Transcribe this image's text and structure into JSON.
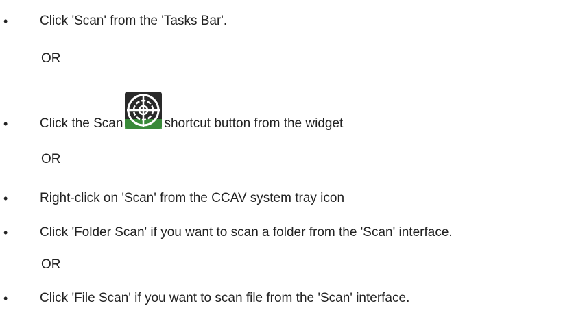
{
  "bullet_symbol": "•",
  "or_text": "OR",
  "steps": [
    "Click 'Scan' from the 'Tasks Bar'.",
    "Click the Scan",
    "shortcut button from the widget",
    "Right-click on 'Scan' from the CCAV system tray icon",
    "Click 'Folder Scan' if you want to scan a folder from the 'Scan' interface.",
    "Click 'File Scan' if you want to scan file from the 'Scan' interface."
  ],
  "icons": {
    "scan": "scan-crosshair-icon"
  },
  "colors": {
    "text": "#222222",
    "icon_bg": "#2a2a2a",
    "icon_fg": "#ffffff",
    "icon_green": "#3c9a3c"
  }
}
